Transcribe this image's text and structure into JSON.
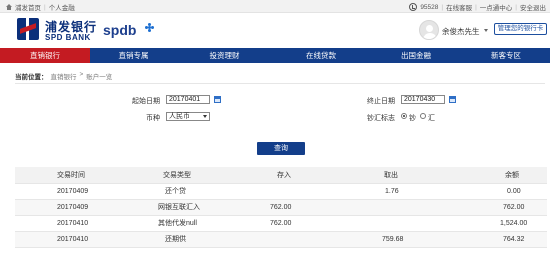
{
  "topbar": {
    "home": "浦发首页",
    "personal": "个人金融",
    "hotline": "95528",
    "links": [
      "在线客服",
      "一点通中心",
      "安全退出"
    ]
  },
  "header": {
    "logo_cn": "浦发银行",
    "logo_en": "SPD BANK",
    "logo_spdb": "spdb",
    "username": "余俊杰先生",
    "manage_button": "管理您的银行卡"
  },
  "nav": {
    "items": [
      {
        "label": "直销银行",
        "active": true
      },
      {
        "label": "直销专属",
        "active": false
      },
      {
        "label": "投资理财",
        "active": false
      },
      {
        "label": "在线贷款",
        "active": false
      },
      {
        "label": "出国金融",
        "active": false
      },
      {
        "label": "新客专区",
        "active": false
      }
    ]
  },
  "breadcrumb": {
    "current_label": "当前位置：",
    "path": [
      "直销银行",
      ">",
      "账户一览"
    ]
  },
  "form": {
    "start_label": "起始日期",
    "start_value": "20170401",
    "end_label": "终止日期",
    "end_value": "20170430",
    "currency_label": "币种",
    "currency_value": "人民币",
    "cash_label": "钞汇标志",
    "cash_options": [
      "钞",
      "汇"
    ],
    "cash_selected": "钞",
    "query_button": "查询"
  },
  "table": {
    "headers": [
      "交易时间",
      "交易类型",
      "存入",
      "取出",
      "余额"
    ],
    "rows": [
      [
        "20170409",
        "还个贷",
        "",
        "1.76",
        "0.00"
      ],
      [
        "20170409",
        "网银互联汇入",
        "762.00",
        "",
        "762.00"
      ],
      [
        "20170410",
        "其他代发null",
        "762.00",
        "",
        "1,524.00"
      ],
      [
        "20170410",
        "还期供",
        "",
        "759.68",
        "764.32"
      ]
    ]
  }
}
